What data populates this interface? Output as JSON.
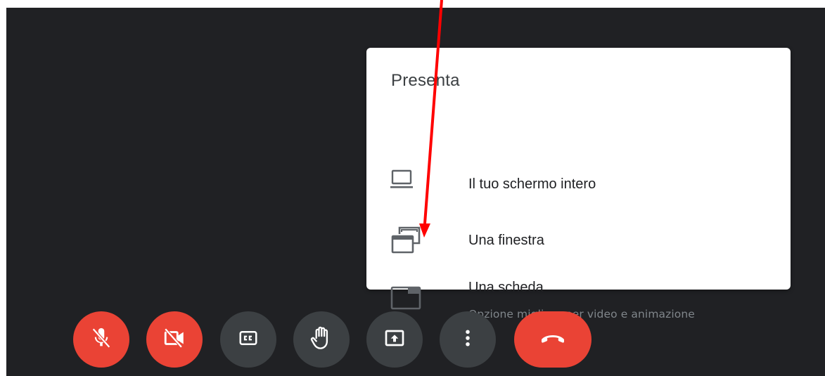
{
  "menu": {
    "title": "Presenta",
    "items": [
      {
        "label": "Il tuo schermo intero",
        "icon": "laptop-icon"
      },
      {
        "label": "Una finestra",
        "icon": "window-icon"
      },
      {
        "label": "Una scheda",
        "sublabel": "Opzione migliore per video e animazione",
        "icon": "tab-icon"
      }
    ]
  },
  "controls": [
    {
      "name": "microphone-off-button",
      "icon": "mic-off-icon",
      "color": "#ea4335"
    },
    {
      "name": "camera-off-button",
      "icon": "videocam-off-icon",
      "color": "#ea4335"
    },
    {
      "name": "captions-button",
      "icon": "closed-captions-icon",
      "color": "#3c4043"
    },
    {
      "name": "raise-hand-button",
      "icon": "hand-icon",
      "color": "#3c4043"
    },
    {
      "name": "present-now-button",
      "icon": "present-to-all-icon",
      "color": "#3c4043"
    },
    {
      "name": "more-options-button",
      "icon": "more-vert-icon",
      "color": "#3c4043"
    },
    {
      "name": "leave-call-button",
      "icon": "call-end-icon",
      "color": "#ea4335"
    }
  ],
  "annotation": {
    "type": "arrow",
    "color": "#ff0000"
  },
  "colors": {
    "background": "#202124",
    "menu": "#ffffff",
    "danger": "#ea4335",
    "control": "#3c4043"
  }
}
